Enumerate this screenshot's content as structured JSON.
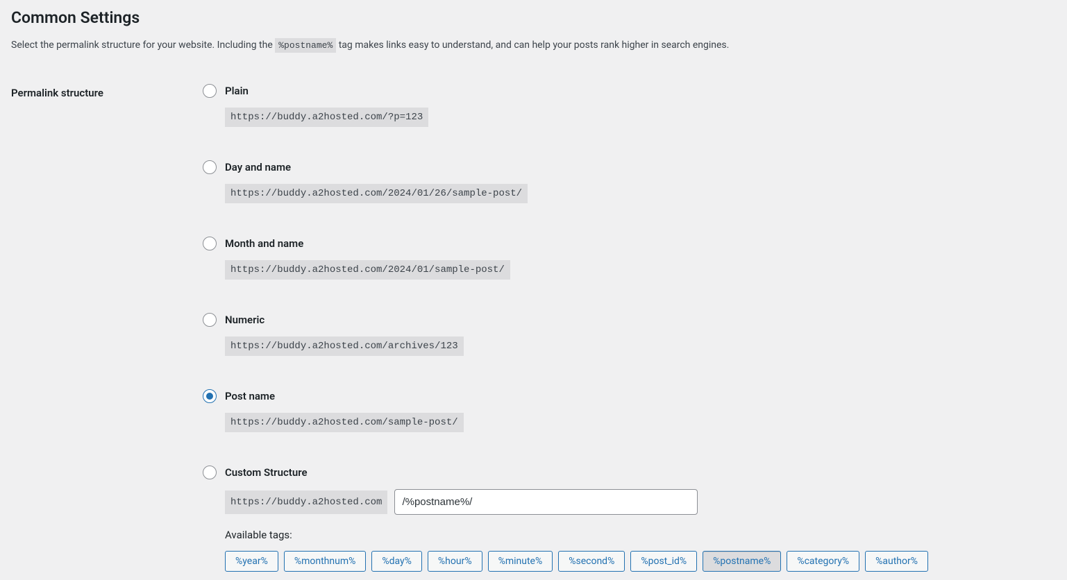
{
  "heading": "Common Settings",
  "description": {
    "prefix": "Select the permalink structure for your website. Including the ",
    "code": "%postname%",
    "suffix": " tag makes links easy to understand, and can help your posts rank higher in search engines."
  },
  "form_label": "Permalink structure",
  "options": {
    "plain": {
      "label": "Plain",
      "example": "https://buddy.a2hosted.com/?p=123"
    },
    "day_name": {
      "label": "Day and name",
      "example": "https://buddy.a2hosted.com/2024/01/26/sample-post/"
    },
    "month_name": {
      "label": "Month and name",
      "example": "https://buddy.a2hosted.com/2024/01/sample-post/"
    },
    "numeric": {
      "label": "Numeric",
      "example": "https://buddy.a2hosted.com/archives/123"
    },
    "post_name": {
      "label": "Post name",
      "example": "https://buddy.a2hosted.com/sample-post/"
    },
    "custom": {
      "label": "Custom Structure",
      "base": "https://buddy.a2hosted.com",
      "value": "/%postname%/"
    }
  },
  "available_tags_label": "Available tags:",
  "tags": [
    "%year%",
    "%monthnum%",
    "%day%",
    "%hour%",
    "%minute%",
    "%second%",
    "%post_id%",
    "%postname%",
    "%category%",
    "%author%"
  ],
  "active_tag_index": 7
}
